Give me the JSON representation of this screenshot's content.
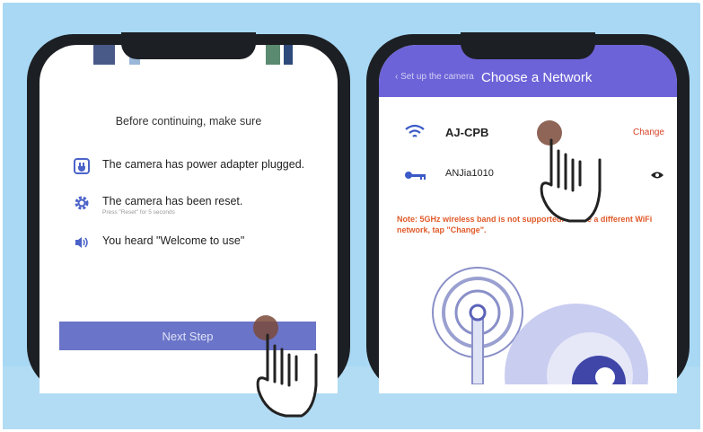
{
  "left_phone": {
    "title": "Before continuing, make sure",
    "items": [
      {
        "icon": "plug-icon",
        "text": "The camera has power adapter plugged."
      },
      {
        "icon": "gear-icon",
        "text": "The camera has been reset.",
        "subtext": "Press \"Reset\" for 5 seconds"
      },
      {
        "icon": "speaker-icon",
        "text": "You heard \"Welcome to use\""
      }
    ],
    "button_label": "Next Step"
  },
  "right_phone": {
    "back_label": "Set up the camera",
    "title": "Choose a Network",
    "ssid": "AJ-CPB",
    "change_label": "Change",
    "password": "ANJia1010",
    "note": "Note: 5GHz wireless band is not supported. To use a different WiFi network, tap \"Change\"."
  },
  "colors": {
    "background": "#a8d8f4",
    "accent": "#6a74c8",
    "header": "#6c63d8",
    "warning": "#e05a2a"
  }
}
